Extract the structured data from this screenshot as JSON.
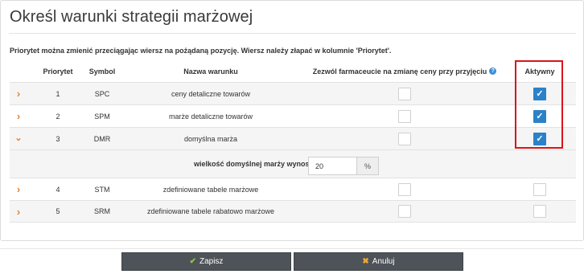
{
  "page": {
    "title": "Określ warunki strategii marżowej",
    "note": "Priorytet można zmienić przeciągając wiersz na pożądaną pozycję. Wiersz należy złapać w kolumnie 'Priorytet'."
  },
  "table": {
    "headers": {
      "priority": "Priorytet",
      "symbol": "Symbol",
      "name": "Nazwa warunku",
      "allow": "Zezwól farmaceucie na zmianę ceny przy przyjęciu",
      "active": "Aktywny"
    },
    "rows": [
      {
        "priority": "1",
        "symbol": "SPC",
        "name": "ceny detaliczne towarów",
        "expanded": false,
        "allow": false,
        "active": true
      },
      {
        "priority": "2",
        "symbol": "SPM",
        "name": "marże detaliczne towarów",
        "expanded": false,
        "allow": false,
        "active": true
      },
      {
        "priority": "3",
        "symbol": "DMR",
        "name": "domyślna marża",
        "expanded": true,
        "allow": false,
        "active": true
      },
      {
        "priority": "4",
        "symbol": "STM",
        "name": "zdefiniowane tabele marżowe",
        "expanded": false,
        "allow": false,
        "active": false
      },
      {
        "priority": "5",
        "symbol": "SRM",
        "name": "zdefiniowane tabele rabatowo marżowe",
        "expanded": false,
        "allow": false,
        "active": false
      }
    ],
    "default_margin": {
      "label": "wielkość domyślnej marży wynosi",
      "value": "20",
      "unit": "%"
    }
  },
  "footer": {
    "save_label": "Zapisz",
    "cancel_label": "Anuluj"
  },
  "colors": {
    "accent": "#2b82c9",
    "chevron": "#e8822f",
    "highlight": "#d9151c",
    "button": "#4d5358"
  },
  "icons": {
    "expand": "chevron-right-icon",
    "collapse": "chevron-down-icon",
    "help": "question-circle-icon",
    "save": "check-icon",
    "cancel": "times-icon"
  }
}
